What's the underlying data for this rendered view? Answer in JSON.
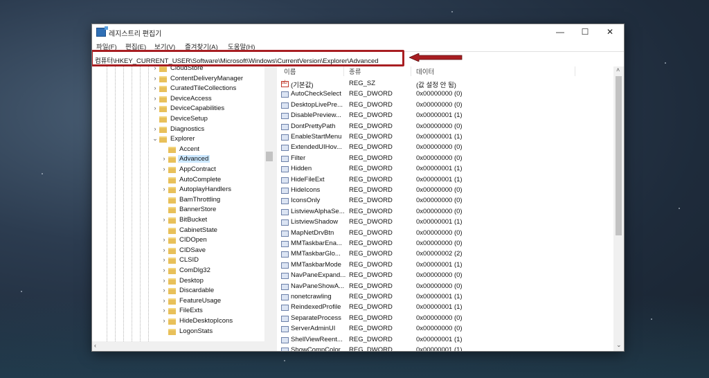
{
  "window": {
    "title": "레지스트리 편집기",
    "controls": {
      "minimize": "—",
      "maximize": "☐",
      "close": "✕"
    }
  },
  "menu": [
    "파일(F)",
    "편집(E)",
    "보기(V)",
    "즐겨찾기(A)",
    "도움말(H)"
  ],
  "address": "컴퓨터\\HKEY_CURRENT_USER\\Software\\Microsoft\\Windows\\CurrentVersion\\Explorer\\Advanced",
  "tree": [
    {
      "label": "CloudStore",
      "level": 1,
      "chevron": "›"
    },
    {
      "label": "ContentDeliveryManager",
      "level": 1,
      "chevron": "›"
    },
    {
      "label": "CuratedTileCollections",
      "level": 1,
      "chevron": "›"
    },
    {
      "label": "DeviceAccess",
      "level": 1,
      "chevron": "›"
    },
    {
      "label": "DeviceCapabilities",
      "level": 1,
      "chevron": "›"
    },
    {
      "label": "DeviceSetup",
      "level": 1,
      "chevron": ""
    },
    {
      "label": "Diagnostics",
      "level": 1,
      "chevron": "›"
    },
    {
      "label": "Explorer",
      "level": 1,
      "chevron": "⌄"
    },
    {
      "label": "Accent",
      "level": 2,
      "chevron": ""
    },
    {
      "label": "Advanced",
      "level": 2,
      "chevron": "›",
      "selected": true
    },
    {
      "label": "AppContract",
      "level": 2,
      "chevron": "›"
    },
    {
      "label": "AutoComplete",
      "level": 2,
      "chevron": ""
    },
    {
      "label": "AutoplayHandlers",
      "level": 2,
      "chevron": "›"
    },
    {
      "label": "BamThrottling",
      "level": 2,
      "chevron": ""
    },
    {
      "label": "BannerStore",
      "level": 2,
      "chevron": ""
    },
    {
      "label": "BitBucket",
      "level": 2,
      "chevron": "›"
    },
    {
      "label": "CabinetState",
      "level": 2,
      "chevron": ""
    },
    {
      "label": "CIDOpen",
      "level": 2,
      "chevron": "›"
    },
    {
      "label": "CIDSave",
      "level": 2,
      "chevron": "›"
    },
    {
      "label": "CLSID",
      "level": 2,
      "chevron": "›"
    },
    {
      "label": "ComDlg32",
      "level": 2,
      "chevron": "›"
    },
    {
      "label": "Desktop",
      "level": 2,
      "chevron": "›"
    },
    {
      "label": "Discardable",
      "level": 2,
      "chevron": "›"
    },
    {
      "label": "FeatureUsage",
      "level": 2,
      "chevron": "›"
    },
    {
      "label": "FileExts",
      "level": 2,
      "chevron": "›"
    },
    {
      "label": "HideDesktopIcons",
      "level": 2,
      "chevron": "›"
    },
    {
      "label": "LogonStats",
      "level": 2,
      "chevron": ""
    }
  ],
  "list": {
    "columns": [
      "이름",
      "종류",
      "데이터"
    ],
    "rows": [
      {
        "name": "(기본값)",
        "type": "REG_SZ",
        "data": "(값 설정 안 됨)",
        "icon": "string-value-icon"
      },
      {
        "name": "AutoCheckSelect",
        "type": "REG_DWORD",
        "data": "0x00000000 (0)",
        "icon": "dword-value-icon"
      },
      {
        "name": "DesktopLivePre...",
        "type": "REG_DWORD",
        "data": "0x00000000 (0)",
        "icon": "dword-value-icon"
      },
      {
        "name": "DisablePreview...",
        "type": "REG_DWORD",
        "data": "0x00000001 (1)",
        "icon": "dword-value-icon"
      },
      {
        "name": "DontPrettyPath",
        "type": "REG_DWORD",
        "data": "0x00000000 (0)",
        "icon": "dword-value-icon"
      },
      {
        "name": "EnableStartMenu",
        "type": "REG_DWORD",
        "data": "0x00000001 (1)",
        "icon": "dword-value-icon"
      },
      {
        "name": "ExtendedUIHov...",
        "type": "REG_DWORD",
        "data": "0x00000000 (0)",
        "icon": "dword-value-icon"
      },
      {
        "name": "Filter",
        "type": "REG_DWORD",
        "data": "0x00000000 (0)",
        "icon": "dword-value-icon"
      },
      {
        "name": "Hidden",
        "type": "REG_DWORD",
        "data": "0x00000001 (1)",
        "icon": "dword-value-icon"
      },
      {
        "name": "HideFileExt",
        "type": "REG_DWORD",
        "data": "0x00000001 (1)",
        "icon": "dword-value-icon"
      },
      {
        "name": "HideIcons",
        "type": "REG_DWORD",
        "data": "0x00000000 (0)",
        "icon": "dword-value-icon"
      },
      {
        "name": "IconsOnly",
        "type": "REG_DWORD",
        "data": "0x00000000 (0)",
        "icon": "dword-value-icon"
      },
      {
        "name": "ListviewAlphaSe...",
        "type": "REG_DWORD",
        "data": "0x00000000 (0)",
        "icon": "dword-value-icon"
      },
      {
        "name": "ListviewShadow",
        "type": "REG_DWORD",
        "data": "0x00000001 (1)",
        "icon": "dword-value-icon"
      },
      {
        "name": "MapNetDrvBtn",
        "type": "REG_DWORD",
        "data": "0x00000000 (0)",
        "icon": "dword-value-icon"
      },
      {
        "name": "MMTaskbarEna...",
        "type": "REG_DWORD",
        "data": "0x00000000 (0)",
        "icon": "dword-value-icon"
      },
      {
        "name": "MMTaskbarGlo...",
        "type": "REG_DWORD",
        "data": "0x00000002 (2)",
        "icon": "dword-value-icon"
      },
      {
        "name": "MMTaskbarMode",
        "type": "REG_DWORD",
        "data": "0x00000001 (1)",
        "icon": "dword-value-icon"
      },
      {
        "name": "NavPaneExpand...",
        "type": "REG_DWORD",
        "data": "0x00000000 (0)",
        "icon": "dword-value-icon"
      },
      {
        "name": "NavPaneShowA...",
        "type": "REG_DWORD",
        "data": "0x00000000 (0)",
        "icon": "dword-value-icon"
      },
      {
        "name": "nonetcrawling",
        "type": "REG_DWORD",
        "data": "0x00000001 (1)",
        "icon": "dword-value-icon"
      },
      {
        "name": "ReindexedProfile",
        "type": "REG_DWORD",
        "data": "0x00000001 (1)",
        "icon": "dword-value-icon"
      },
      {
        "name": "SeparateProcess",
        "type": "REG_DWORD",
        "data": "0x00000000 (0)",
        "icon": "dword-value-icon"
      },
      {
        "name": "ServerAdminUI",
        "type": "REG_DWORD",
        "data": "0x00000000 (0)",
        "icon": "dword-value-icon"
      },
      {
        "name": "ShellViewReent...",
        "type": "REG_DWORD",
        "data": "0x00000001 (1)",
        "icon": "dword-value-icon"
      },
      {
        "name": "ShowCompColor",
        "type": "REG_DWORD",
        "data": "0x00000001 (1)",
        "icon": "dword-value-icon"
      }
    ]
  },
  "colors": {
    "highlight_border": "#a81e22",
    "selection": "#cce8ff",
    "arrow": "#a81e22"
  }
}
